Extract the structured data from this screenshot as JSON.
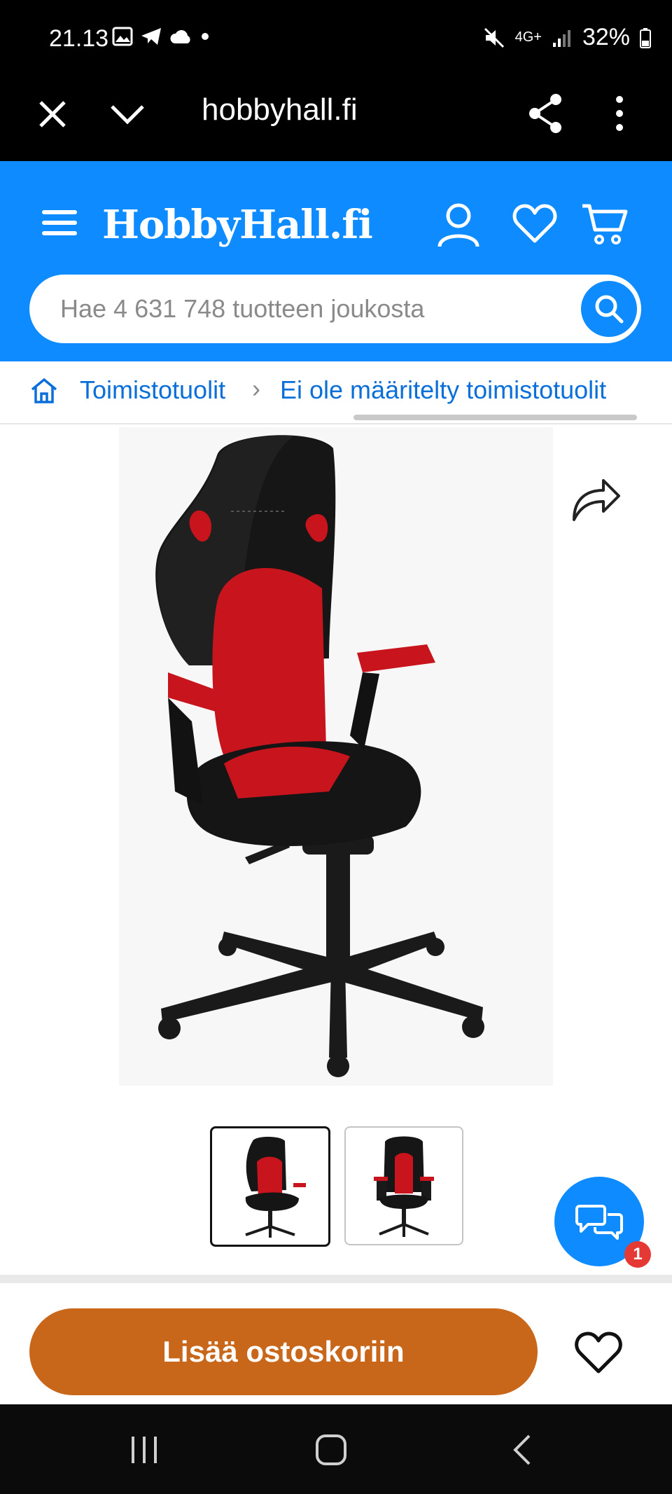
{
  "status_bar": {
    "time": "21.13",
    "network": "4G+",
    "battery": "32%"
  },
  "browser": {
    "url": "hobbyhall.fi",
    "close_icon": "close-icon",
    "collapse_icon": "chevron-down-icon",
    "share_icon": "share-icon",
    "menu_icon": "more-vertical-icon"
  },
  "header": {
    "logo": "HobbyHall.fi",
    "search_placeholder": "Hae 4 631 748 tuotteen joukosta",
    "brand_color": "#0d8bff"
  },
  "breadcrumb": {
    "items": [
      "Toimistotuolit",
      "Ei ole määritelty toimistotuolit"
    ],
    "separator": "›"
  },
  "product": {
    "images": [
      "chair-front-angled",
      "chair-front"
    ],
    "selected_image": 0
  },
  "chat": {
    "unread": "1"
  },
  "actions": {
    "add_to_cart": "Lisää ostoskoriin",
    "button_color": "#c8661a"
  }
}
